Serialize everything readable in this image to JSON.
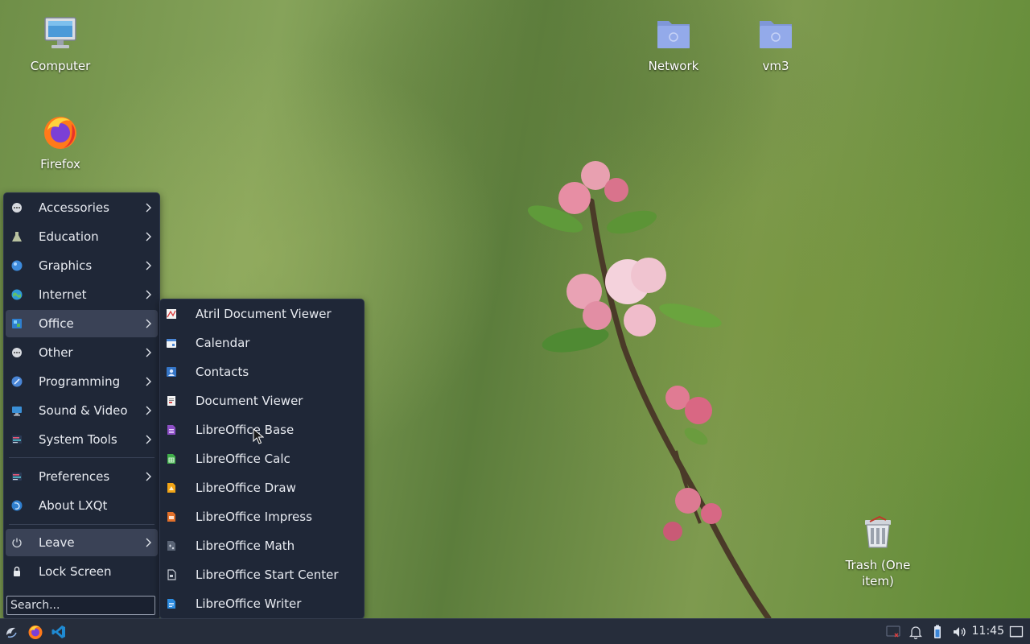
{
  "desktop": {
    "icons": [
      {
        "label": "Computer",
        "icon": "computer-icon"
      },
      {
        "label": "Firefox",
        "icon": "firefox-icon"
      },
      {
        "label": "Network",
        "icon": "network-folder-icon"
      },
      {
        "label": "vm3",
        "icon": "folder-icon"
      },
      {
        "label": "Trash (One item)",
        "icon": "trash-icon"
      }
    ]
  },
  "main_menu": {
    "items": [
      {
        "label": "Accessories",
        "icon": "accessories-icon",
        "submenu": true
      },
      {
        "label": "Education",
        "icon": "education-icon",
        "submenu": true
      },
      {
        "label": "Graphics",
        "icon": "graphics-icon",
        "submenu": true
      },
      {
        "label": "Internet",
        "icon": "internet-icon",
        "submenu": true
      },
      {
        "label": "Office",
        "icon": "office-icon",
        "submenu": true
      },
      {
        "label": "Other",
        "icon": "other-icon",
        "submenu": true
      },
      {
        "label": "Programming",
        "icon": "programming-icon",
        "submenu": true
      },
      {
        "label": "Sound & Video",
        "icon": "sound-video-icon",
        "submenu": true
      },
      {
        "label": "System Tools",
        "icon": "system-tools-icon",
        "submenu": true
      },
      {
        "label": "Preferences",
        "icon": "preferences-icon",
        "submenu": true
      },
      {
        "label": "About LXQt",
        "icon": "lxqt-icon",
        "submenu": false
      },
      {
        "label": "Leave",
        "icon": "power-icon",
        "submenu": true
      },
      {
        "label": "Lock Screen",
        "icon": "lock-icon",
        "submenu": false
      }
    ],
    "search_placeholder": "Search..."
  },
  "office_submenu": {
    "items": [
      {
        "label": "Atril Document Viewer",
        "icon": "atril-icon"
      },
      {
        "label": "Calendar",
        "icon": "calendar-icon"
      },
      {
        "label": "Contacts",
        "icon": "contacts-icon"
      },
      {
        "label": "Document Viewer",
        "icon": "document-viewer-icon"
      },
      {
        "label": "LibreOffice Base",
        "icon": "libreoffice-base-icon"
      },
      {
        "label": "LibreOffice Calc",
        "icon": "libreoffice-calc-icon"
      },
      {
        "label": "LibreOffice Draw",
        "icon": "libreoffice-draw-icon"
      },
      {
        "label": "LibreOffice Impress",
        "icon": "libreoffice-impress-icon"
      },
      {
        "label": "LibreOffice Math",
        "icon": "libreoffice-math-icon"
      },
      {
        "label": "LibreOffice Start Center",
        "icon": "libreoffice-start-center-icon"
      },
      {
        "label": "LibreOffice Writer",
        "icon": "libreoffice-writer-icon"
      }
    ]
  },
  "taskbar": {
    "clock": "11:45",
    "launchers": [
      "start-menu-icon",
      "firefox-icon",
      "vscode-icon"
    ],
    "tray": [
      "network-disconnected-icon",
      "notification-bell-icon",
      "battery-icon",
      "volume-icon",
      "show-desktop-icon"
    ]
  },
  "colors": {
    "menu_bg": "#1f2737",
    "menu_hover": "#3a4256",
    "taskbar_bg": "#262d3b",
    "folder_blue": "#8ea6e6"
  }
}
